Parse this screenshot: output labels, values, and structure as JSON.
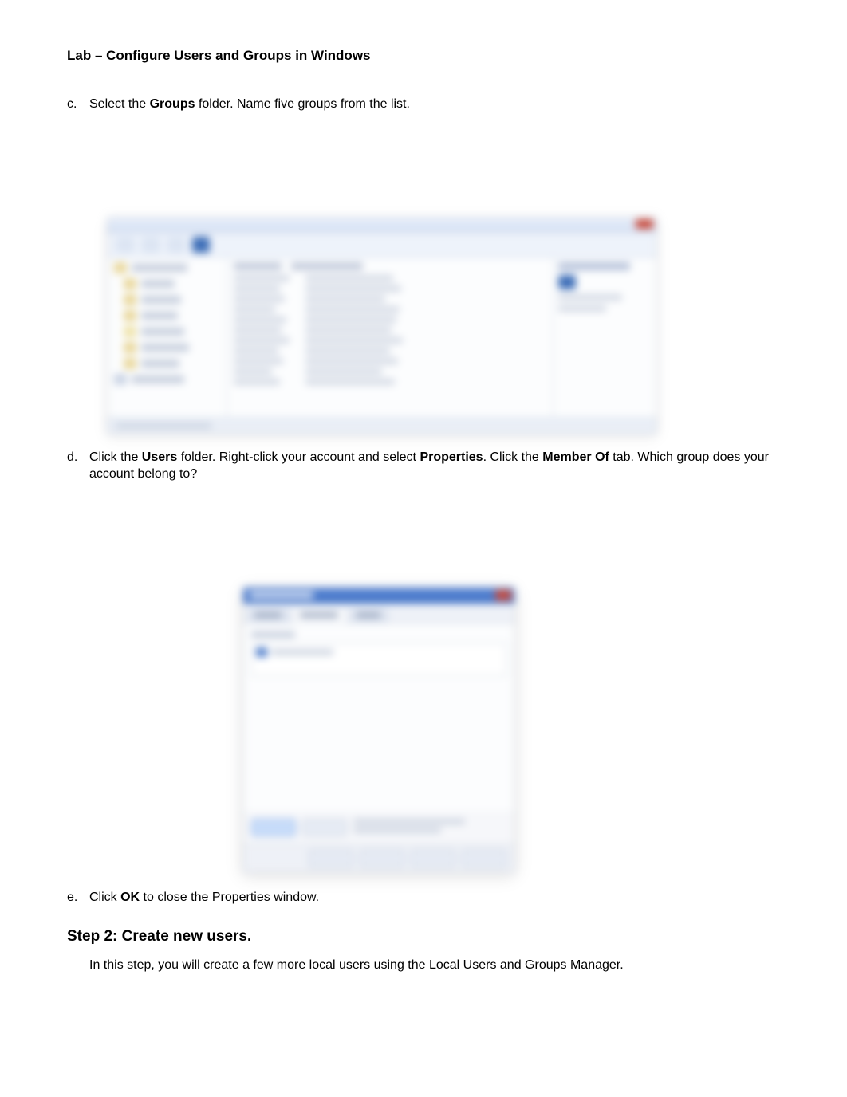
{
  "title": "Lab – Configure Users and Groups in Windows",
  "items": {
    "c": {
      "letter": "c.",
      "pre": "Select the ",
      "bold": "Groups",
      "post": " folder. Name five groups from the list."
    },
    "d": {
      "letter": "d.",
      "p1_pre": "Click the ",
      "p1_b1": "Users",
      "p1_mid1": " folder. Right-click your account and select ",
      "p1_b2": "Properties",
      "p1_mid2": ". Click the ",
      "p1_b3": "Member Of",
      "p1_post": " tab. Which group does your account belong to?"
    },
    "e": {
      "letter": "e.",
      "pre": "Click ",
      "bold": "OK",
      "post": " to close the Properties window."
    }
  },
  "step2": {
    "heading": "Step 2: Create new users.",
    "sub_pre": "In this step, you will create a few more local users using the ",
    "sub_bold": "Local Users and Groups Manager",
    "sub_post": "."
  }
}
